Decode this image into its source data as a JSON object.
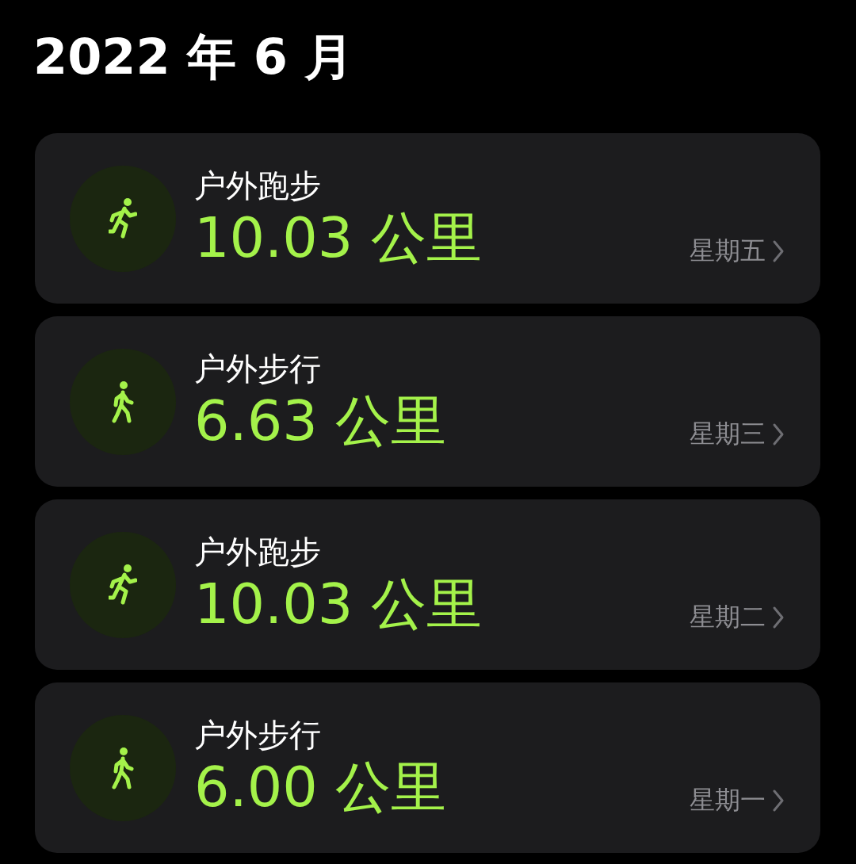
{
  "header": {
    "title": "2022 年 6 月"
  },
  "workouts": [
    {
      "kind": "run",
      "name": "户外跑步",
      "distance": "10.03 公里",
      "day": "星期五"
    },
    {
      "kind": "walk",
      "name": "户外步行",
      "distance": "6.63 公里",
      "day": "星期三"
    },
    {
      "kind": "run",
      "name": "户外跑步",
      "distance": "10.03 公里",
      "day": "星期二"
    },
    {
      "kind": "walk",
      "name": "户外步行",
      "distance": "6.00 公里",
      "day": "星期一"
    }
  ]
}
